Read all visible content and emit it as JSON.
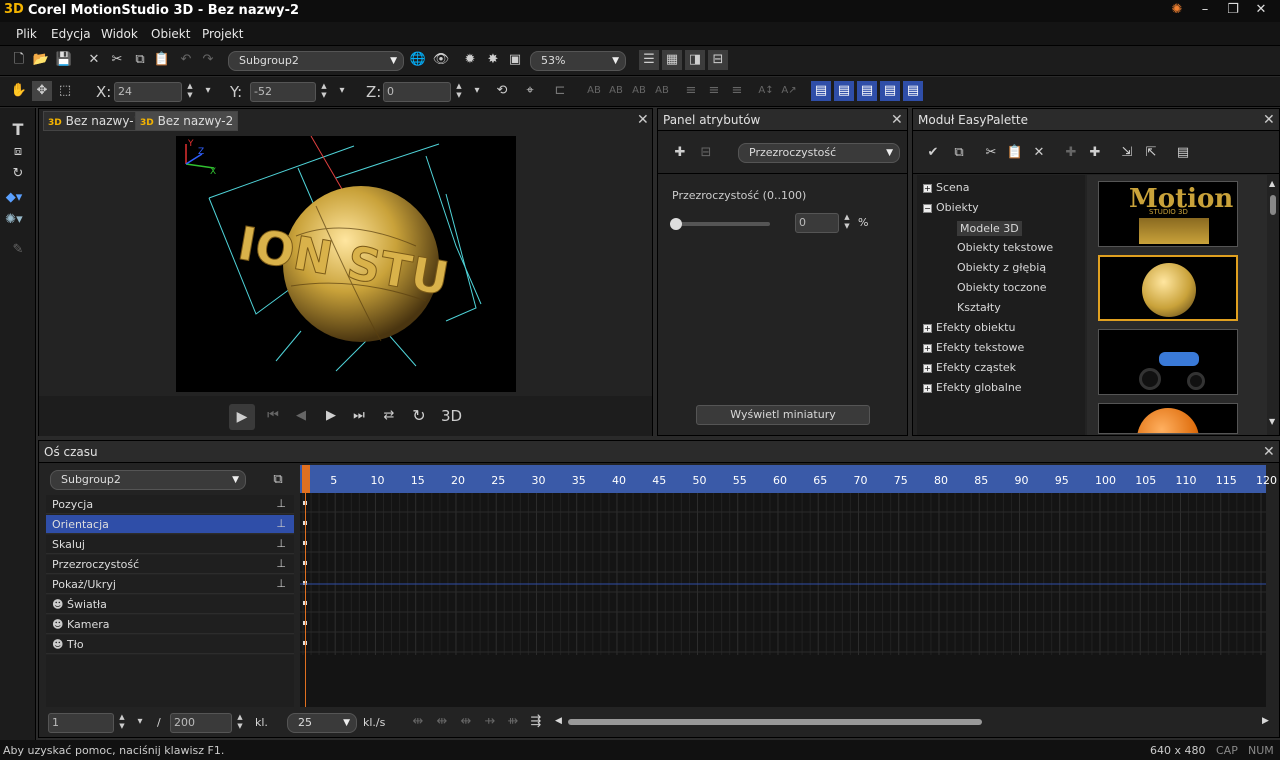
{
  "titlebar": {
    "logo": "3D",
    "title": "Corel MotionStudio 3D - Bez nazwy-2"
  },
  "menu": [
    "Plik",
    "Edycja",
    "Widok",
    "Obiekt",
    "Projekt"
  ],
  "toolbar": {
    "group_combo": "Subgroup2",
    "zoom_combo": "53%"
  },
  "coords": {
    "x_label": "X:",
    "x_value": "24",
    "y_label": "Y:",
    "y_value": "-52",
    "z_label": "Z:",
    "z_value": "0"
  },
  "doc_tabs": [
    {
      "icon": "3D",
      "label": "Bez nazwy-1"
    },
    {
      "icon": "3D",
      "label": "Bez nazwy-2"
    }
  ],
  "playback": {
    "label_3d": "3D"
  },
  "attr_panel": {
    "title": "Panel atrybutów",
    "combo": "Przezroczystość",
    "section": "Przezroczystość (0..100)",
    "value": "0",
    "unit": "%",
    "slider": 0,
    "button": "Wyświetl miniatury"
  },
  "easy_palette": {
    "title": "Moduł EasyPalette",
    "tree": [
      {
        "label": "Scena",
        "expander": "+"
      },
      {
        "label": "Obiekty",
        "expander": "−"
      },
      {
        "label": "Modele 3D",
        "child": true,
        "selected": true
      },
      {
        "label": "Obiekty tekstowe",
        "child": true
      },
      {
        "label": "Obiekty z głębią",
        "child": true
      },
      {
        "label": "Obiekty toczone",
        "child": true
      },
      {
        "label": "Kształty",
        "child": true
      },
      {
        "label": "Efekty obiektu",
        "expander": "+"
      },
      {
        "label": "Efekty tekstowe",
        "expander": "+"
      },
      {
        "label": "Efekty cząstek",
        "expander": "+"
      },
      {
        "label": "Efekty globalne",
        "expander": "+"
      }
    ],
    "thumb_text": "Motion",
    "thumb_sub": "STUDIO 3D"
  },
  "timeline": {
    "title": "Oś czasu",
    "group": "Subgroup2",
    "rows": [
      {
        "label": "Pozycja",
        "pin": "📌"
      },
      {
        "label": "Orientacja",
        "pin": "📌",
        "selected": true
      },
      {
        "label": "Skaluj",
        "pin": "📌"
      },
      {
        "label": "Przezroczystość",
        "pin": "📌"
      },
      {
        "label": "Pokaż/Ukryj",
        "pin": "📌"
      },
      {
        "label": "Światła",
        "group": true
      },
      {
        "label": "Kamera",
        "group": true
      },
      {
        "label": "Tło",
        "group": true
      }
    ],
    "ruler": [
      "1",
      "5",
      "10",
      "15",
      "20",
      "25",
      "30",
      "35",
      "40",
      "45",
      "50",
      "55",
      "60",
      "65",
      "70",
      "75",
      "80",
      "85",
      "90",
      "95",
      "100",
      "105",
      "110",
      "115",
      "120"
    ],
    "frame": "1",
    "sep": "/",
    "total": "200",
    "unit": "kl.",
    "fps": "25",
    "fps_unit": "kl./s"
  },
  "statusbar": {
    "help": "Aby uzyskać pomoc, naciśnij klawisz F1.",
    "resolution": "640 x 480",
    "cap": "CAP",
    "num": "NUM"
  },
  "colors": {
    "accent": "#2f4ea8",
    "ruler": "#3a5aa8",
    "gold": "#c9a23a",
    "cursor": "#e07020"
  }
}
